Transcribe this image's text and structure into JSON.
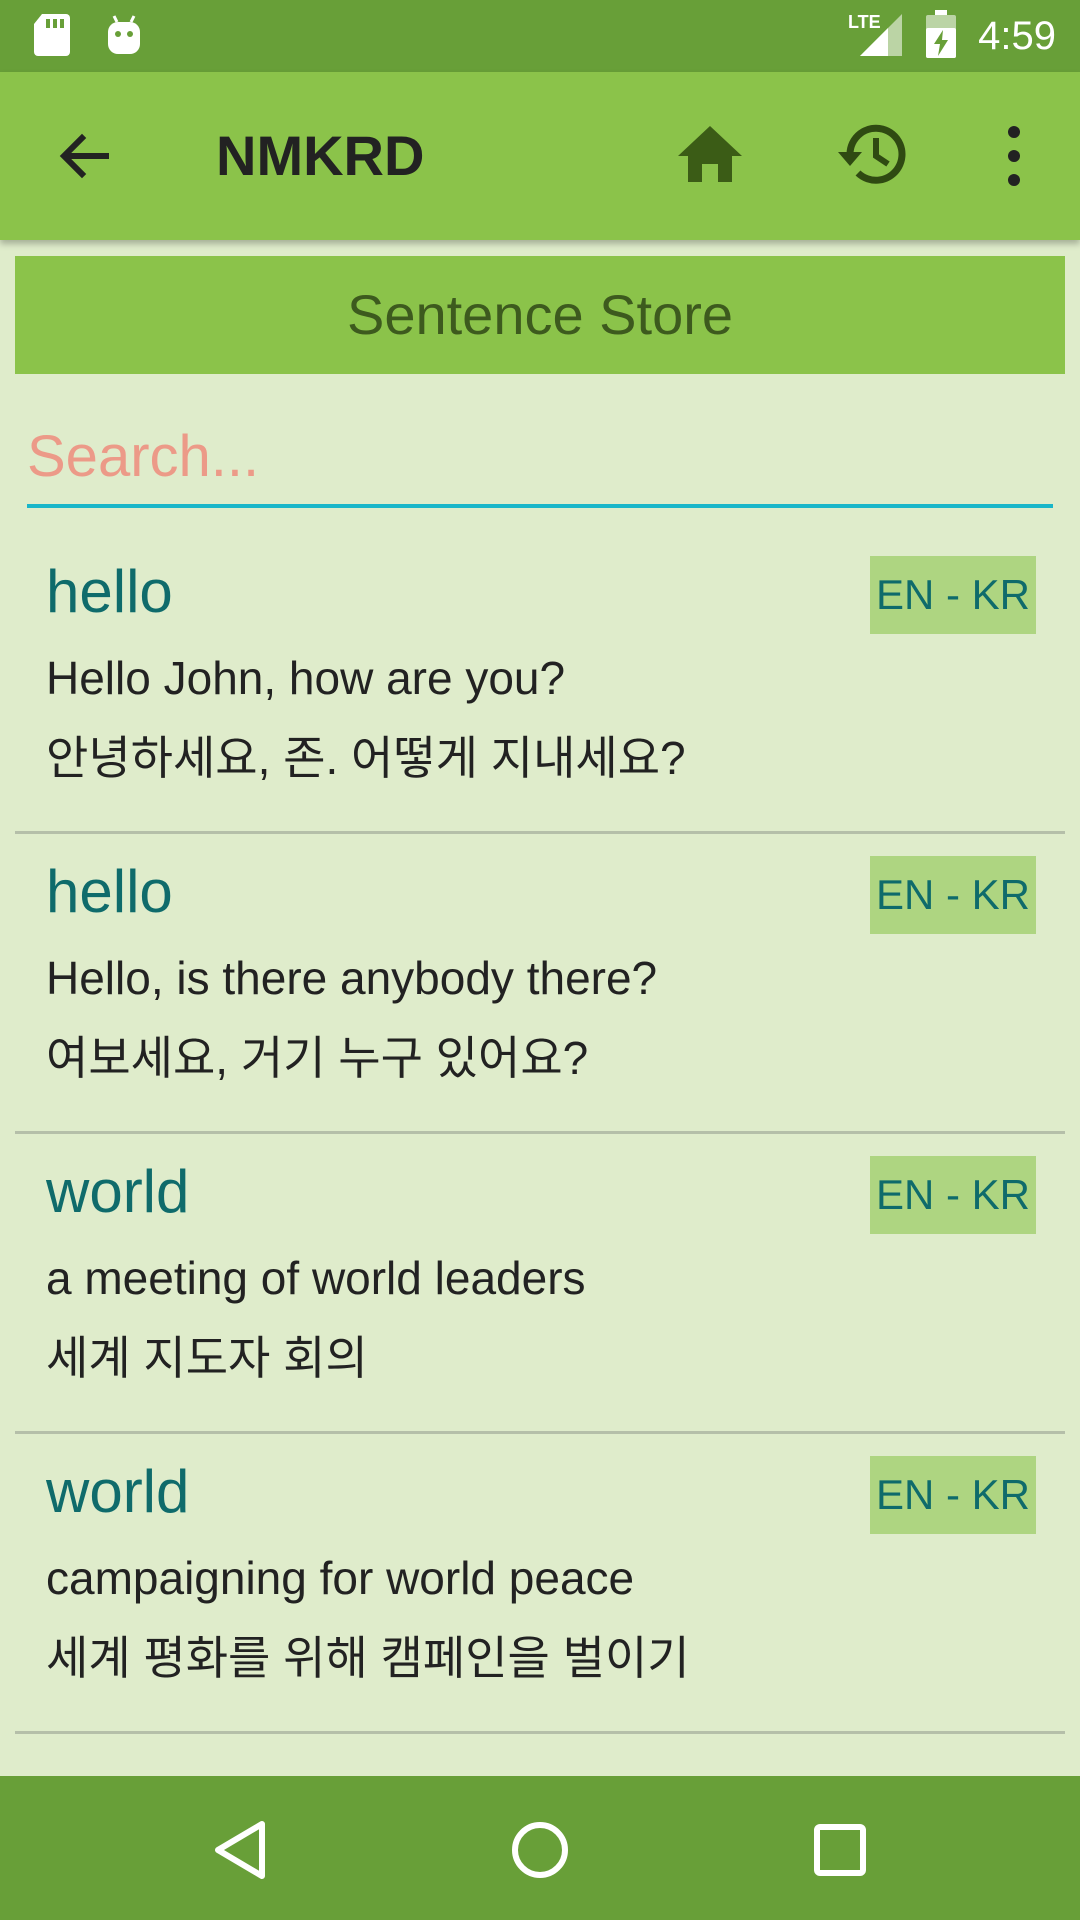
{
  "status_bar": {
    "time": "4:59",
    "network": "LTE",
    "icons": [
      "sd-card-icon",
      "android-icon",
      "lte-signal-icon",
      "battery-icon"
    ]
  },
  "app_bar": {
    "title": "NMKRD",
    "icons": [
      "back-arrow-icon",
      "home-icon",
      "history-icon",
      "more-vert-icon"
    ]
  },
  "section": {
    "title": "Sentence Store"
  },
  "search": {
    "placeholder": "Search..."
  },
  "items": [
    {
      "word": "hello",
      "lang": "EN - KR",
      "en": "Hello John, how are you?",
      "kr": "안녕하세요, 존. 어떻게 지내세요?"
    },
    {
      "word": "hello",
      "lang": "EN - KR",
      "en": "Hello, is there anybody there?",
      "kr": "여보세요, 거기 누구 있어요?"
    },
    {
      "word": "world",
      "lang": "EN - KR",
      "en": "a meeting of world leaders",
      "kr": "세계 지도자 회의"
    },
    {
      "word": "world",
      "lang": "EN - KR",
      "en": "campaigning for world peace",
      "kr": "세계 평화를 위해 캠페인을 벌이기"
    }
  ],
  "colors": {
    "status_bar": "#689f38",
    "app_bar": "#8bc34a",
    "background": "#dfeccb",
    "accent": "#19b6c9",
    "word_text": "#0f6b6b",
    "badge": "#aed581"
  },
  "nav_bar": {
    "icons": [
      "nav-back-icon",
      "nav-home-icon",
      "nav-recents-icon"
    ]
  }
}
